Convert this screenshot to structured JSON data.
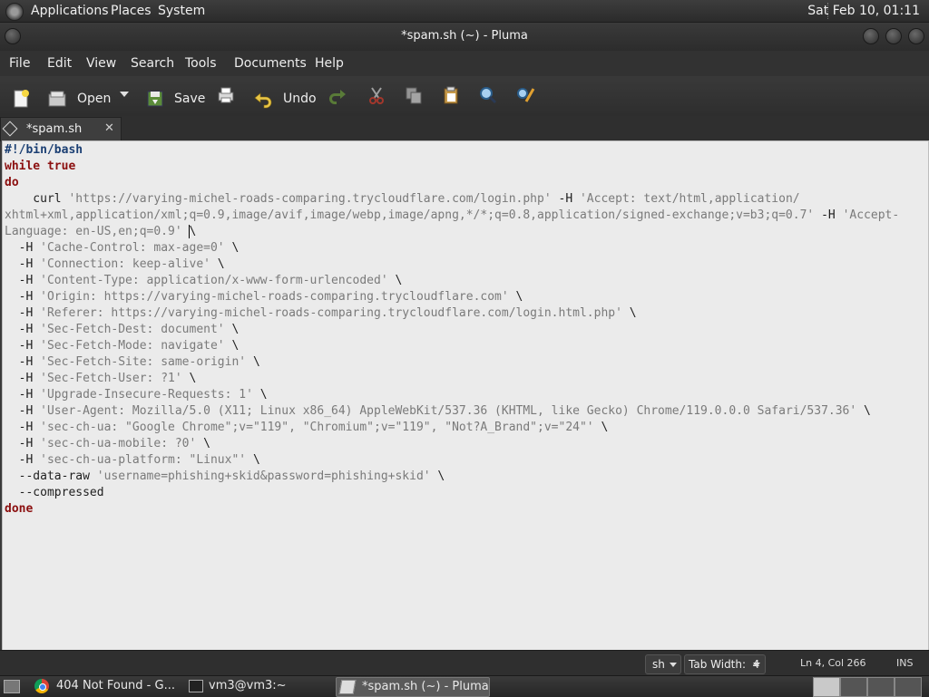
{
  "top_panel": {
    "applications": "Applications",
    "places": "Places",
    "system": "System",
    "clock": "Sat Feb 10, 01:11"
  },
  "window": {
    "title": "*spam.sh (~) - Pluma"
  },
  "menubar": [
    "File",
    "Edit",
    "View",
    "Search",
    "Tools",
    "Documents",
    "Help"
  ],
  "toolbar": {
    "open_label": "Open",
    "save_label": "Save",
    "undo_label": "Undo"
  },
  "tab": {
    "label": "*spam.sh",
    "close": "✕"
  },
  "code": {
    "l1": "#!/bin/bash",
    "l2a": "while",
    "l2b": "true",
    "l3": "do",
    "l4a": "    curl ",
    "l4b": "'https://varying-michel-roads-comparing.trycloudflare.com/login.php'",
    "l4c": " -H ",
    "l4d": "'Accept: text/html,application/",
    "l5a": "xhtml+xml,application/xml;q=0.9,image/avif,image/webp,image/apng,*/*;q=0.8,application/signed-exchange;v=b3;q=0.7'",
    "l5b": " -H ",
    "l5c": "'Accept-",
    "l6a": "Language: en-US,en;q=0.9'",
    "l6b": " \\",
    "h1": "'Cache-Control: max-age=0'",
    "h2": "'Connection: keep-alive'",
    "h3": "'Content-Type: application/x-www-form-urlencoded'",
    "h4": "'Origin: https://varying-michel-roads-comparing.trycloudflare.com'",
    "h5": "'Referer: https://varying-michel-roads-comparing.trycloudflare.com/login.html.php'",
    "h6": "'Sec-Fetch-Dest: document'",
    "h7": "'Sec-Fetch-Mode: navigate'",
    "h8": "'Sec-Fetch-Site: same-origin'",
    "h9": "'Sec-Fetch-User: ?1'",
    "h10": "'Upgrade-Insecure-Requests: 1'",
    "h11": "'User-Agent: Mozilla/5.0 (X11; Linux x86_64) AppleWebKit/537.36 (KHTML, like Gecko) Chrome/119.0.0.0 Safari/537.36'",
    "h12": "'sec-ch-ua: \"Google Chrome\";v=\"119\", \"Chromium\";v=\"119\", \"Not?A_Brand\";v=\"24\"'",
    "h13": "'sec-ch-ua-mobile: ?0'",
    "h14": "'sec-ch-ua-platform: \"Linux\"'",
    "hflag": "  -H ",
    "cont": " \\",
    "raw_flag": "  --data-raw ",
    "raw_val": "'username=phishing+skid&password=phishing+skid'",
    "compressed": "  --compressed",
    "done": "done"
  },
  "statusbar": {
    "language": "sh",
    "tab_width": "Tab Width:  4",
    "position": "Ln 4, Col 266",
    "mode": "INS"
  },
  "taskbar": {
    "task1": "404 Not Found - G...",
    "task2": "vm3@vm3:~",
    "task3": "*spam.sh (~) - Pluma"
  },
  "colors": {
    "keyword": "#8b0f0f",
    "shebang": "#1b3f73",
    "string": "#7a7a7a",
    "editor_bg": "#ebebeb"
  },
  "icons": [
    "system-logo-icon",
    "new-document-icon",
    "open-icon",
    "save-icon",
    "print-icon",
    "undo-icon",
    "redo-icon",
    "cut-icon",
    "copy-icon",
    "paste-icon",
    "find-icon",
    "replace-icon",
    "chevron-down-icon",
    "close-icon",
    "chrome-icon",
    "terminal-icon",
    "pluma-icon"
  ]
}
